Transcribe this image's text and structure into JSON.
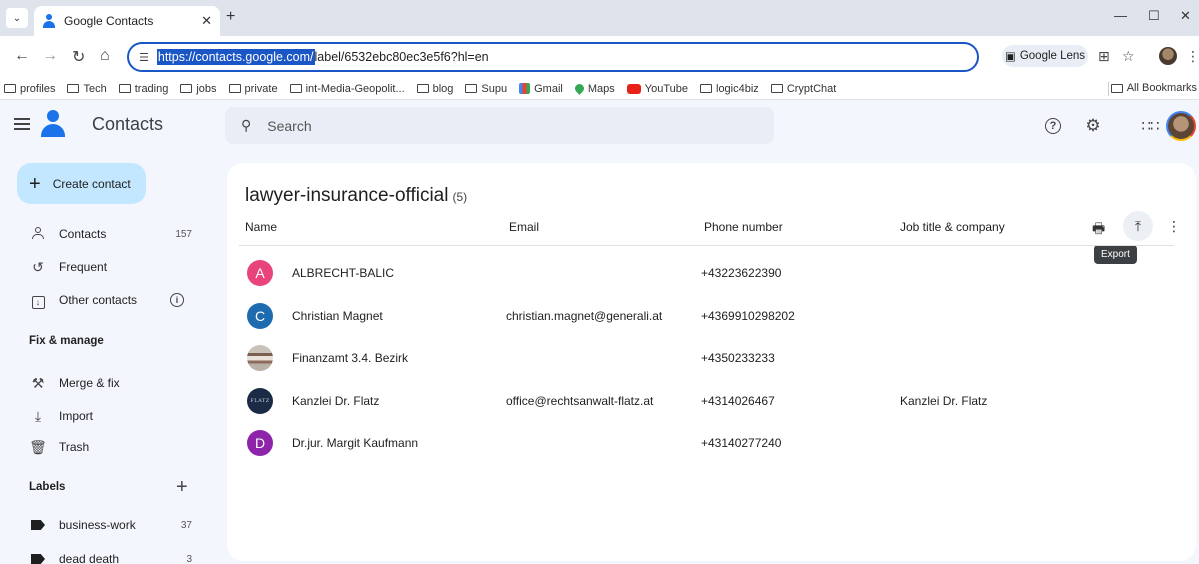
{
  "browser": {
    "tab_title": "Google Contacts",
    "url_selected": "https://contacts.google.com/",
    "url_rest": "label/6532ebc80ec3e5f6?hl=en",
    "lens_label": "Google Lens",
    "bookmarks": [
      "profiles",
      "Tech",
      "trading",
      "jobs",
      "private",
      "int-Media-Geopolit...",
      "blog",
      "Supu",
      "Gmail",
      "Maps",
      "YouTube",
      "logic4biz",
      "CryptChat"
    ],
    "all_bookmarks": "All Bookmarks"
  },
  "app": {
    "title": "Contacts",
    "search_placeholder": "Search"
  },
  "sidebar": {
    "create_label": "Create contact",
    "items": [
      {
        "label": "Contacts",
        "count": "157"
      },
      {
        "label": "Frequent"
      },
      {
        "label": "Other contacts"
      }
    ],
    "fix_heading": "Fix & manage",
    "fix_items": [
      {
        "label": "Merge & fix"
      },
      {
        "label": "Import"
      },
      {
        "label": "Trash"
      }
    ],
    "labels_heading": "Labels",
    "labels": [
      {
        "label": "business-work",
        "count": "37"
      },
      {
        "label": "dead death",
        "count": "3"
      }
    ]
  },
  "main": {
    "list_title": "lawyer-insurance-official",
    "list_count": "(5)",
    "columns": [
      "Name",
      "Email",
      "Phone number",
      "Job title & company"
    ],
    "tooltip": "Export",
    "rows": [
      {
        "initial": "A",
        "avatar_color": "#e8437a",
        "name": "ALBRECHT-BALIC",
        "email": "",
        "phone": "+43223622390",
        "job": ""
      },
      {
        "initial": "C",
        "avatar_color": "#1f6bb0",
        "name": "Christian Magnet",
        "email": "christian.magnet@generali.at",
        "phone": "+4369910298202",
        "job": ""
      },
      {
        "initial": "",
        "avatar_color": "",
        "name": "Finanzamt 3.4. Bezirk",
        "email": "",
        "phone": "+4350233233",
        "job": ""
      },
      {
        "initial": "FLATZ",
        "avatar_color": "#1b2a45",
        "name": "Kanzlei Dr. Flatz",
        "email": "office@rechtsanwalt-flatz.at",
        "phone": "+4314026467",
        "job": "Kanzlei Dr. Flatz"
      },
      {
        "initial": "D",
        "avatar_color": "#8e24aa",
        "name": "Dr.jur. Margit Kaufmann",
        "email": "",
        "phone": "+43140277240",
        "job": ""
      }
    ]
  }
}
